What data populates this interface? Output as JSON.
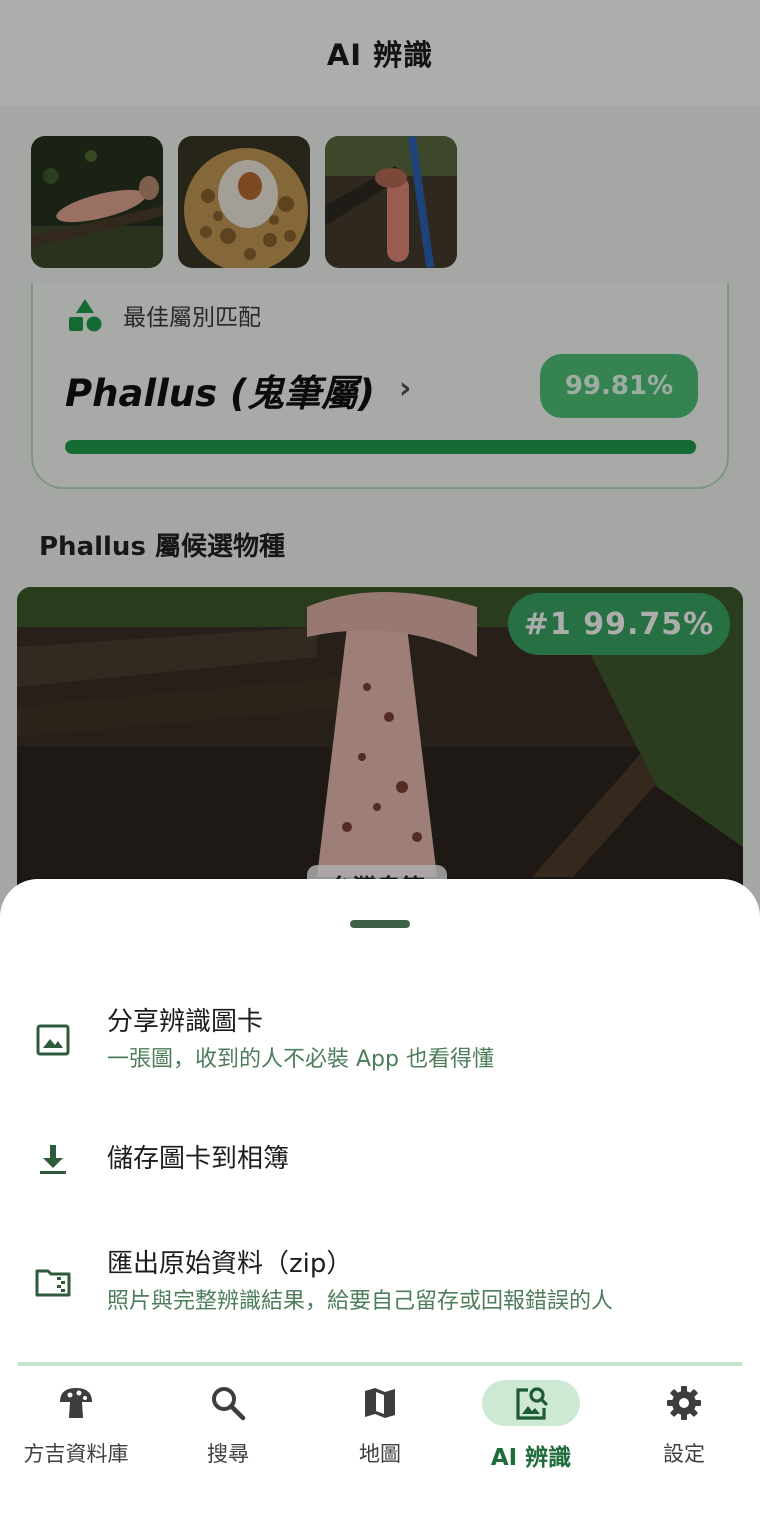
{
  "header": {
    "title": "AI 辨識"
  },
  "best_match": {
    "label": "最佳屬別匹配",
    "genus": "Phallus (鬼筆屬)",
    "percent": "99.81%",
    "progress_fraction": 0.9981
  },
  "candidates": {
    "section_title": "Phallus 屬候選物種",
    "items": [
      {
        "rank_label": "#1  99.75%",
        "name": "台灣鬼筆"
      }
    ]
  },
  "sheet": {
    "items": [
      {
        "icon": "image-icon",
        "title": "分享辨識圖卡",
        "subtitle": "一張圖，收到的人不必裝 App 也看得懂"
      },
      {
        "icon": "download-icon",
        "title": "儲存圖卡到相簿"
      },
      {
        "icon": "folder-zip-icon",
        "title": "匯出原始資料（zip）",
        "subtitle": "照片與完整辨識結果，給要自己留存或回報錯誤的人"
      }
    ]
  },
  "nav": {
    "items": [
      {
        "icon": "mushroom-icon",
        "label": "方吉資料庫"
      },
      {
        "icon": "search-icon",
        "label": "搜尋"
      },
      {
        "icon": "map-icon",
        "label": "地圖"
      },
      {
        "icon": "image-search-icon",
        "label": "AI 辨識",
        "active": true
      },
      {
        "icon": "gear-icon",
        "label": "設定"
      }
    ]
  },
  "colors": {
    "accent": "#1e9d4c",
    "nav_active_bg": "#cde8d3",
    "sheet_subtitle": "#4d7d5a"
  }
}
